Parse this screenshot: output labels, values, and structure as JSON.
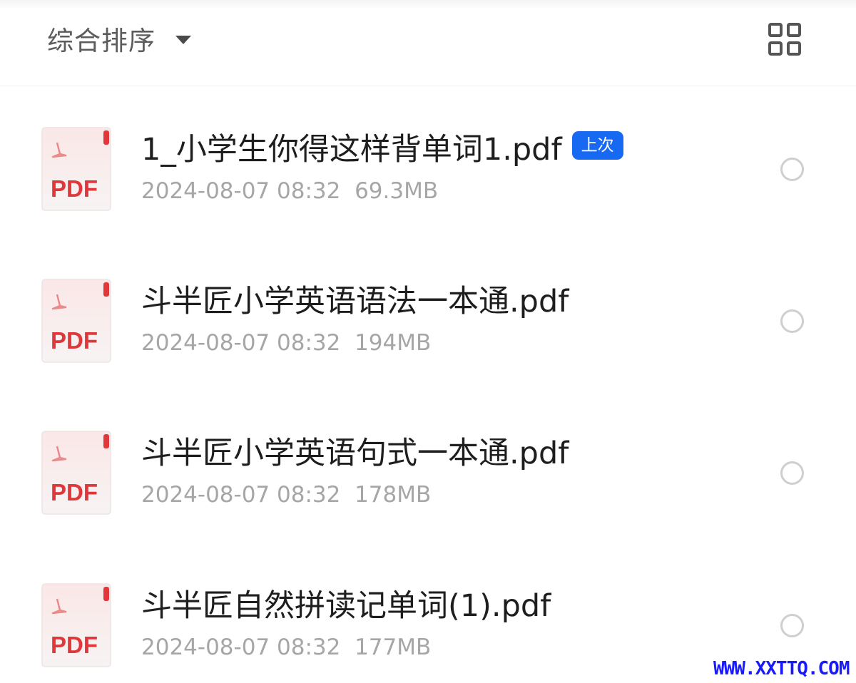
{
  "toolbar": {
    "sort_label": "综合排序",
    "sort_caret_icon": "caret-down-icon",
    "view_toggle_icon": "grid-view-icon"
  },
  "files": [
    {
      "name": "1_小学生你得这样背单词1.pdf",
      "badge": "上次",
      "date": "2024-08-07 08:32",
      "size": "69.3MB",
      "icon": "pdf-file-icon"
    },
    {
      "name": "斗半匠小学英语语法一本通.pdf",
      "date": "2024-08-07 08:32",
      "size": "194MB",
      "icon": "pdf-file-icon"
    },
    {
      "name": "斗半匠小学英语句式一本通.pdf",
      "date": "2024-08-07 08:32",
      "size": "178MB",
      "icon": "pdf-file-icon"
    },
    {
      "name": "斗半匠自然拼读记单词(1).pdf",
      "date": "2024-08-07 08:32",
      "size": "177MB",
      "icon": "pdf-file-icon"
    }
  ],
  "pdf_icon_label": "PDF",
  "watermark": "WWW.XXTTQ.COM",
  "colors": {
    "badge": "#1769f2",
    "pdf_red": "#e0373a",
    "meta_text": "#a6a6a6",
    "watermark": "#1a1aff"
  }
}
